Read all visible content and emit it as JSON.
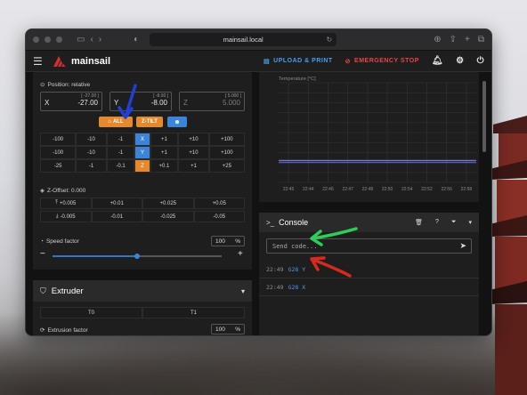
{
  "browser": {
    "url": "mainsail.local"
  },
  "app": {
    "brand": "mainsail",
    "upload_print": "UPLOAD & PRINT",
    "emergency_stop": "EMERGENCY STOP"
  },
  "toolhead": {
    "position_label": "Position: relative",
    "axes": [
      {
        "label": "X",
        "value": "-27.00",
        "hint": "[ -27.00 ]"
      },
      {
        "label": "Y",
        "value": "-8.00",
        "hint": "[ -8.00 ]"
      },
      {
        "label": "Z",
        "value": "5.000",
        "hint": "[ 5.000 ]"
      }
    ],
    "home_all": "ALL",
    "z_tilt": "Z-TILT",
    "jog_rows": [
      [
        "-100",
        "-10",
        "-1",
        "X",
        "+1",
        "+10",
        "+100"
      ],
      [
        "-100",
        "-10",
        "-1",
        "Y",
        "+1",
        "+10",
        "+100"
      ],
      [
        "-25",
        "-1",
        "-0.1",
        "Z",
        "+0.1",
        "+1",
        "+25"
      ]
    ],
    "z_offset_label": "Z-Offset: 0.000",
    "z_offset_up": [
      "+0.005",
      "+0.01",
      "+0.025",
      "+0.05"
    ],
    "z_offset_down": [
      "-0.005",
      "-0.01",
      "-0.025",
      "-0.05"
    ],
    "speed_factor_label": "Speed factor",
    "speed_factor_value": "100",
    "speed_factor_unit": "%",
    "speed_factor_fraction": 0.5
  },
  "extruder": {
    "title": "Extruder",
    "tools": [
      "T0",
      "T1"
    ],
    "extrusion_factor_label": "Extrusion factor",
    "extrusion_factor_value": "100",
    "extrusion_factor_unit": "%"
  },
  "chart_data": {
    "type": "line",
    "title": "",
    "ylabel": "Temperature [°C]",
    "x": [
      "22:45",
      "22:44",
      "22:46",
      "22:47",
      "22:48",
      "22:50",
      "22:54",
      "22:52",
      "22:56",
      "22:58"
    ],
    "series": [
      {
        "values": [
          22,
          22,
          22,
          22,
          22,
          22,
          22,
          22,
          22,
          22
        ]
      },
      {
        "values": [
          20,
          20,
          20,
          20,
          20,
          20,
          20,
          20,
          20,
          20
        ]
      }
    ],
    "grid": true
  },
  "console": {
    "title": "Console",
    "placeholder": "Send code...",
    "entries": [
      {
        "time": "22:49",
        "cmd": "G28 Y"
      },
      {
        "time": "22:49",
        "cmd": "G28 X"
      }
    ]
  },
  "colors": {
    "accent_blue": "#3c84d8",
    "accent_orange": "#e5892a",
    "emergency_red": "#e84545",
    "arrow_blue": "#1f3fd6",
    "arrow_green": "#2ecc5b",
    "arrow_red": "#d9281f"
  }
}
